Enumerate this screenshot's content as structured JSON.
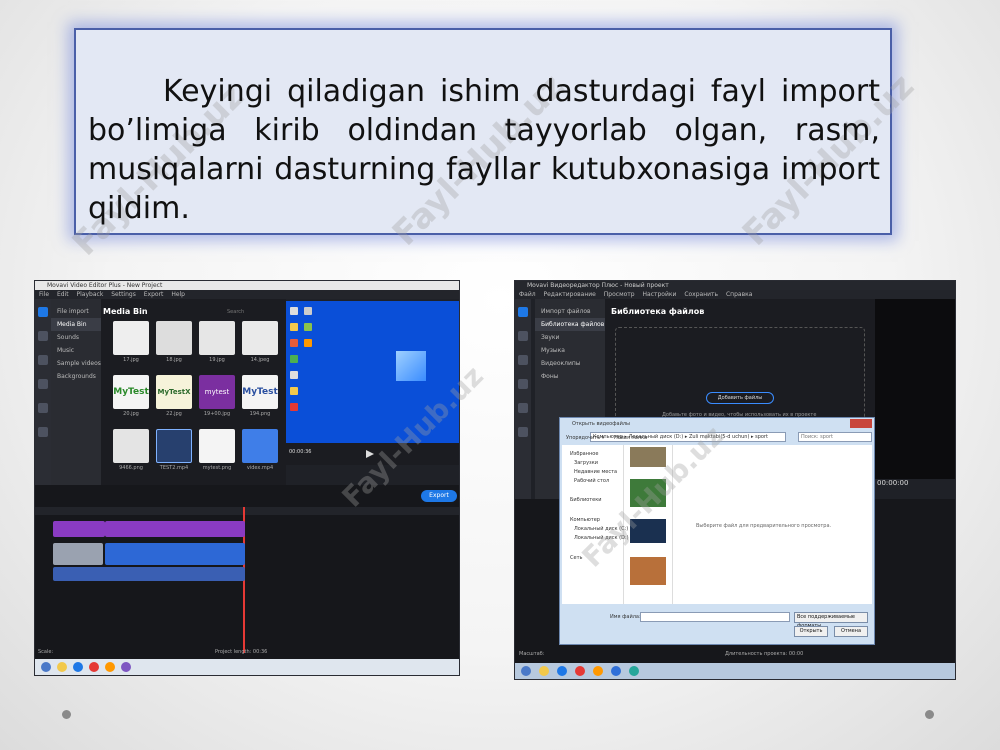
{
  "slide": {
    "paragraph": "Keyingi qiladigan ishim dasturdagi fayl import bo’limiga kirib oldindan tayyorlab olgan, rasm, musiqalarni dasturning fayllar kutubxonasiga import qildim.",
    "watermark": "Fayl-Hub.uz"
  },
  "shotA": {
    "title": "Movavi Video Editor Plus - New Project",
    "menu": [
      "File",
      "Edit",
      "Playback",
      "Settings",
      "Export",
      "Help"
    ],
    "categories": [
      "File import",
      "Media Bin",
      "Sounds",
      "Music",
      "Sample videos",
      "Backgrounds"
    ],
    "panel_title": "Media Bin",
    "search_placeholder": "Search",
    "thumbs": [
      "17.jpg",
      "18.jpg",
      "19.jpg",
      "14.jpeg",
      "20.jpg",
      "22.jpg",
      "19+00.jpg",
      "194.png",
      "9466.png",
      "TEST2.mp4",
      "mytest.png",
      "videx.mp4"
    ],
    "time": "00:00:36",
    "export_label": "Export",
    "scale_label": "Scale:",
    "project_length": "Project length: 00:36"
  },
  "shotB": {
    "title": "Movavi Видеоредактор Плюс - Новый проект",
    "menu": [
      "Файл",
      "Редактирование",
      "Просмотр",
      "Настройки",
      "Сохранить",
      "Справка"
    ],
    "categories": [
      "Импорт файлов",
      "Библиотека файлов",
      "Звуки",
      "Музыка",
      "Видеоклипы",
      "Фоны"
    ],
    "panel_title": "Библиотека файлов",
    "add_files": "Добавить файлы",
    "add_hint": "Добавьте фото и видео, чтобы использовать их в проекте",
    "time": "00:00:00",
    "dialog": {
      "title": "Открыть видеофайлы",
      "path": "Компьютер ▸ Локальный диск (D:) ▸ Zuli maktabi(5-d uchun) ▸ sport",
      "search": "Поиск: sport",
      "organize": "Упорядочить ▾",
      "new_folder": "Новая папка",
      "nav": [
        "Избранное",
        "Загрузки",
        "Недавние места",
        "Рабочий стол",
        "Библиотеки",
        "Компьютер",
        "Локальный диск (C:)",
        "Локальный диск (D:)",
        "Сеть"
      ],
      "preview_hint": "Выберите файл для предварительного просмотра.",
      "filename_label": "Имя файла:",
      "filter": "Все поддерживаемые форматы",
      "open_btn": "Открыть",
      "cancel_btn": "Отмена"
    },
    "scale_label": "Масштаб:",
    "project_length": "Длительность проекта: 00:00"
  }
}
